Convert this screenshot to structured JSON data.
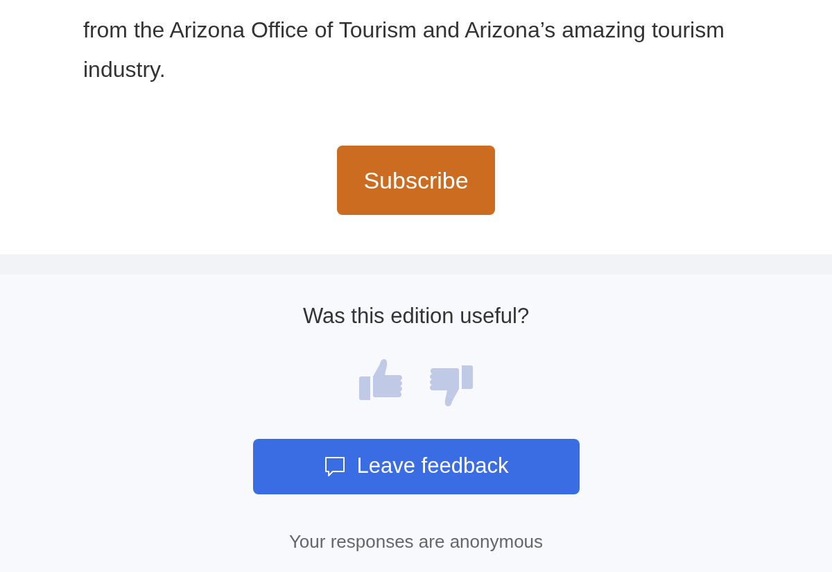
{
  "intro_text": "from the Arizona Office of Tourism and Arizona’s amazing tourism industry.",
  "subscribe_button": "Subscribe",
  "feedback": {
    "question": "Was this edition useful?",
    "button": "Leave feedback",
    "note": "Your responses are anonymous"
  }
}
